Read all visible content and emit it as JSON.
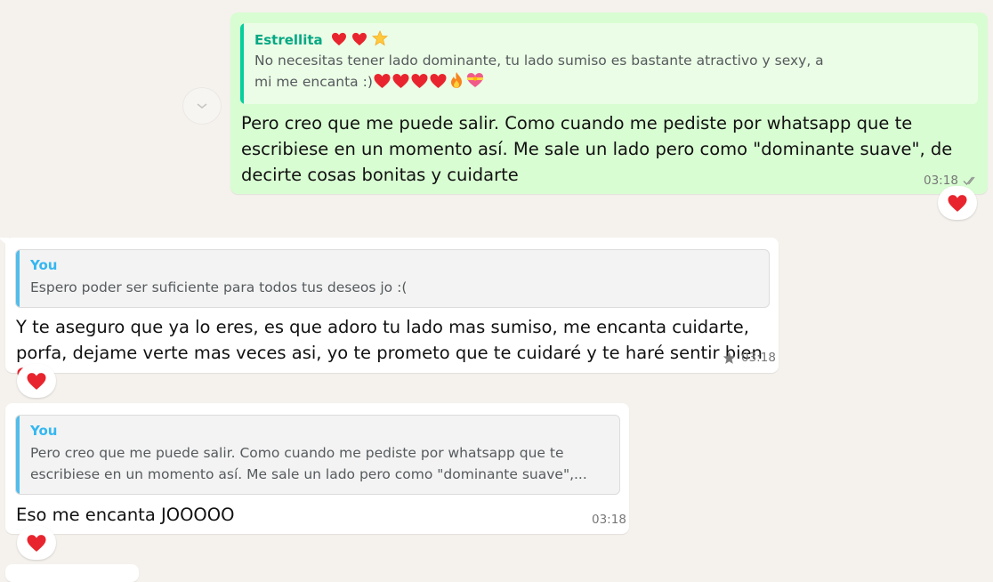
{
  "messages": [
    {
      "direction": "outgoing",
      "quote": {
        "author": "Estrellita",
        "author_emoji": [
          "red-heart",
          "red-heart",
          "glowing-star"
        ],
        "text": "No necesitas tener lado dominante, tu lado sumiso es bastante atractivo y sexy, a mi me encanta :)",
        "trailing_emoji": [
          "red-heart",
          "red-heart",
          "red-heart",
          "red-heart",
          "fire",
          "heart-with-ribbon"
        ]
      },
      "text": "Pero creo que me puede salir. Como cuando me pediste por whatsapp que te escribiese en un momento así. Me sale un lado pero como \"dominante suave\", de decirte cosas bonitas y cuidarte",
      "time": "03:18",
      "status": "read-double-check",
      "reaction": "red-heart"
    },
    {
      "direction": "incoming",
      "quote": {
        "author": "You",
        "text": "Espero poder ser suficiente para todos tus deseos jo :("
      },
      "text": "Y te aseguro que ya lo eres, es que adoro tu lado mas sumiso, me encanta cuidarte, porfa, dejame verte mas veces asi, yo te prometo que te cuidaré y te haré sentir bien",
      "text_emoji": "red-heart",
      "starred": true,
      "time": "03:18",
      "reaction": "red-heart"
    },
    {
      "direction": "incoming",
      "quote": {
        "author": "You",
        "text": "Pero creo que me puede salir. Como cuando me pediste por whatsapp que te escribiese en un momento así. Me sale un lado pero como \"dominante suave\",..."
      },
      "text": "Eso me encanta JOOOOO",
      "time": "03:18",
      "reaction": "red-heart"
    }
  ],
  "scroll_down_icon": "chevron-down-icon",
  "colors": {
    "background": "#f5f2ee",
    "outgoing_bubble": "#d8fdd2",
    "incoming_bubble": "#ffffff",
    "quote_author_outgoing": "#06a884",
    "quote_author_incoming": "#34b7f1",
    "heart": "#e8252e"
  }
}
